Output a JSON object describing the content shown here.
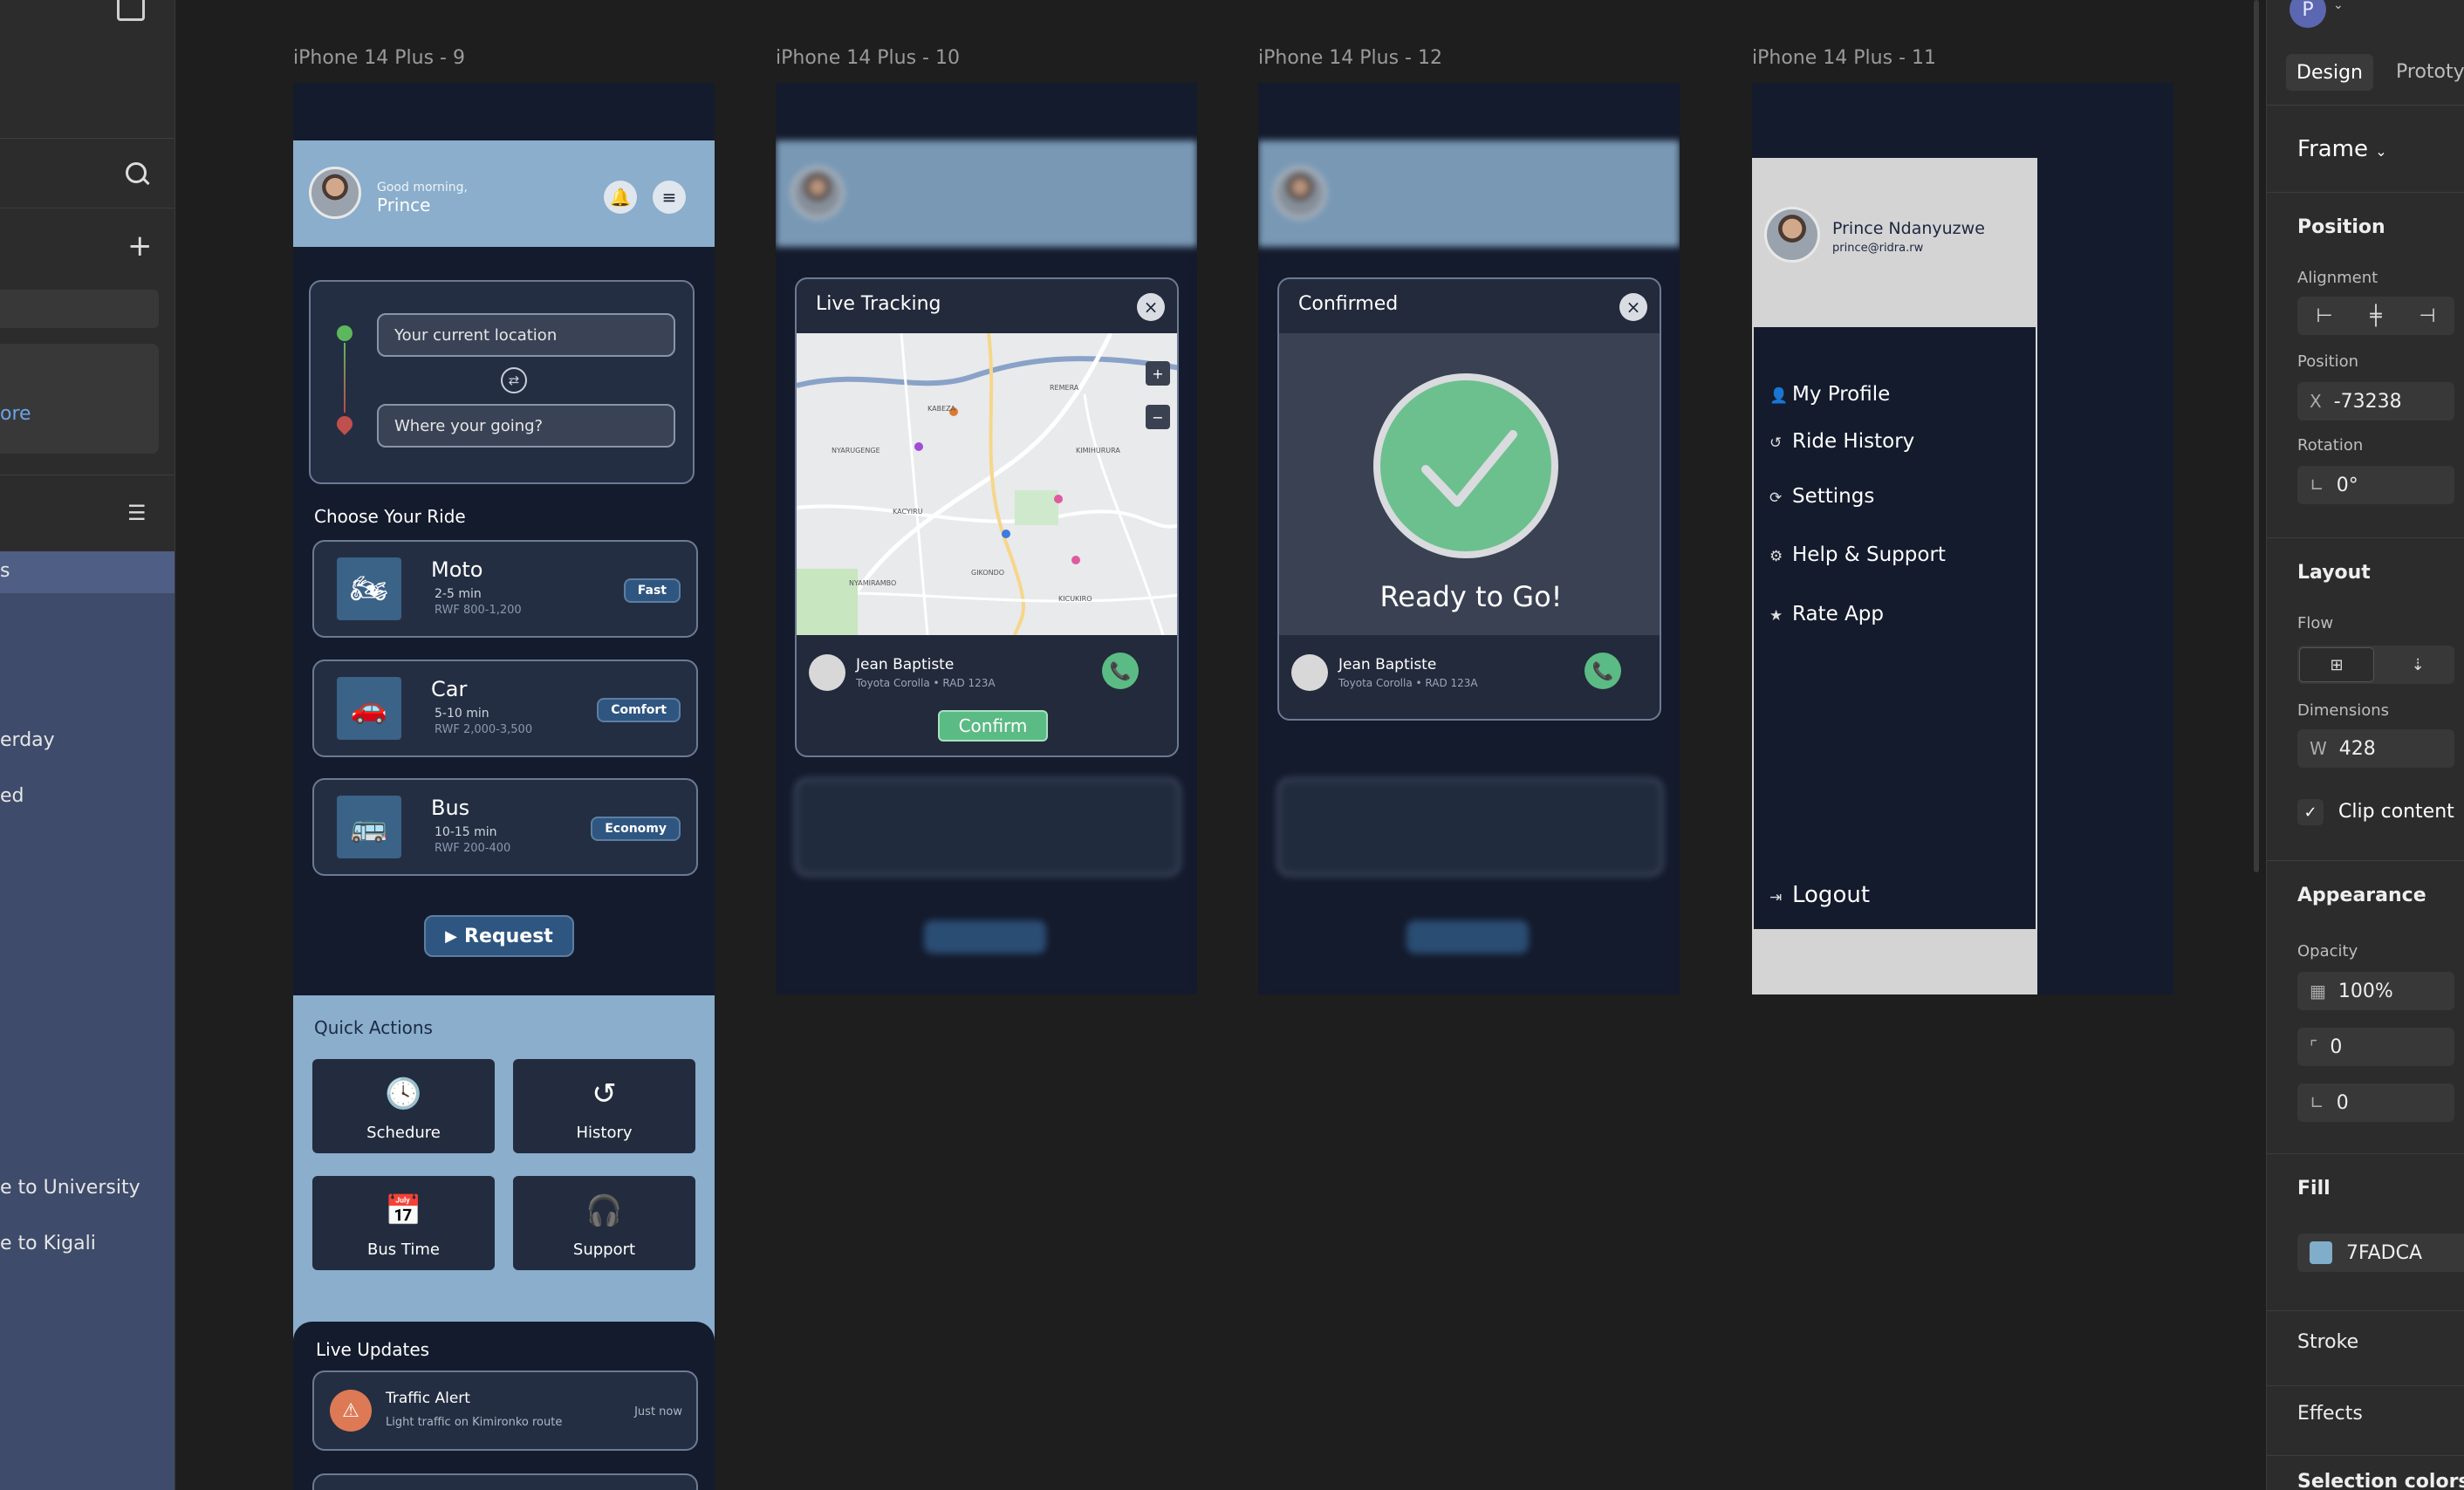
{
  "left_panel": {
    "items": [
      "ore",
      "erday",
      "ed",
      "e to University",
      "e to Kigali"
    ]
  },
  "canvas": {
    "frames": [
      {
        "label": "iPhone 14 Plus - 9"
      },
      {
        "label": "iPhone 14 Plus - 10"
      },
      {
        "label": "iPhone 14 Plus - 12"
      },
      {
        "label": "iPhone 14 Plus - 11"
      }
    ]
  },
  "home": {
    "greeting": "Good morning,",
    "name": "Prince",
    "current_location": "Your current location",
    "destination": "Where your going?",
    "choose_title": "Choose Your Ride",
    "rides": [
      {
        "name": "Moto",
        "time": "2-5 min",
        "price": "RWF 800-1,200",
        "tag": "Fast",
        "icon": "motorcycle-icon"
      },
      {
        "name": "Car",
        "time": "5-10 min",
        "price": "RWF 2,000-3,500",
        "tag": "Comfort",
        "icon": "car-icon"
      },
      {
        "name": "Bus",
        "time": "10-15 min",
        "price": "RWF 200-400",
        "tag": "Economy",
        "icon": "bus-icon"
      }
    ],
    "request_label": "Request",
    "quick_actions_title": "Quick Actions",
    "quick_actions": [
      "Schedure",
      "History",
      "Bus Time",
      "Support"
    ],
    "live_updates_title": "Live Updates",
    "alert_title": "Traffic Alert",
    "alert_text": "Light traffic on Kimironko route",
    "alert_time": "Just now"
  },
  "tracking": {
    "title": "Live Tracking",
    "driver": "Jean Baptiste",
    "vehicle": "Toyota Corolla • RAD 123A",
    "confirm_label": "Confirm",
    "map_labels": [
      "KABEZA",
      "REMERA",
      "KICUKIRO",
      "NYARUGENGE",
      "GIKONDO",
      "KIMIHURURA",
      "KACYIRU",
      "NYAMIRAMBO"
    ]
  },
  "confirmed": {
    "title": "Confirmed",
    "ready": "Ready to Go!",
    "driver": "Jean Baptiste",
    "vehicle": "Toyota Corolla • RAD 123A"
  },
  "menu": {
    "name": "Prince Ndanyuzwe",
    "email": "prince@ridra.rw",
    "items": [
      "My Profile",
      "Ride History",
      "Settings",
      "Help & Support",
      "Rate App"
    ],
    "logout": "Logout"
  },
  "properties": {
    "tabs": [
      "Design",
      "Prototy"
    ],
    "avatar_letter": "P",
    "frame_label": "Frame",
    "position_title": "Position",
    "alignment_label": "Alignment",
    "position_label": "Position",
    "x_prefix": "X",
    "x_value": "-73238",
    "rotation_label": "Rotation",
    "rotation_value": "0°",
    "layout_title": "Layout",
    "flow_label": "Flow",
    "dimensions_label": "Dimensions",
    "w_prefix": "W",
    "w_value": "428",
    "clip_label": "Clip content",
    "appearance_title": "Appearance",
    "opacity_label": "Opacity",
    "opacity_value": "100%",
    "radius_value": "0",
    "corner_value": "0",
    "fill_title": "Fill",
    "fill_hex": "7FADCA",
    "fill_color": "#7FADCA",
    "stroke_title": "Stroke",
    "effects_title": "Effects",
    "selection_colors_title": "Selection colors"
  }
}
